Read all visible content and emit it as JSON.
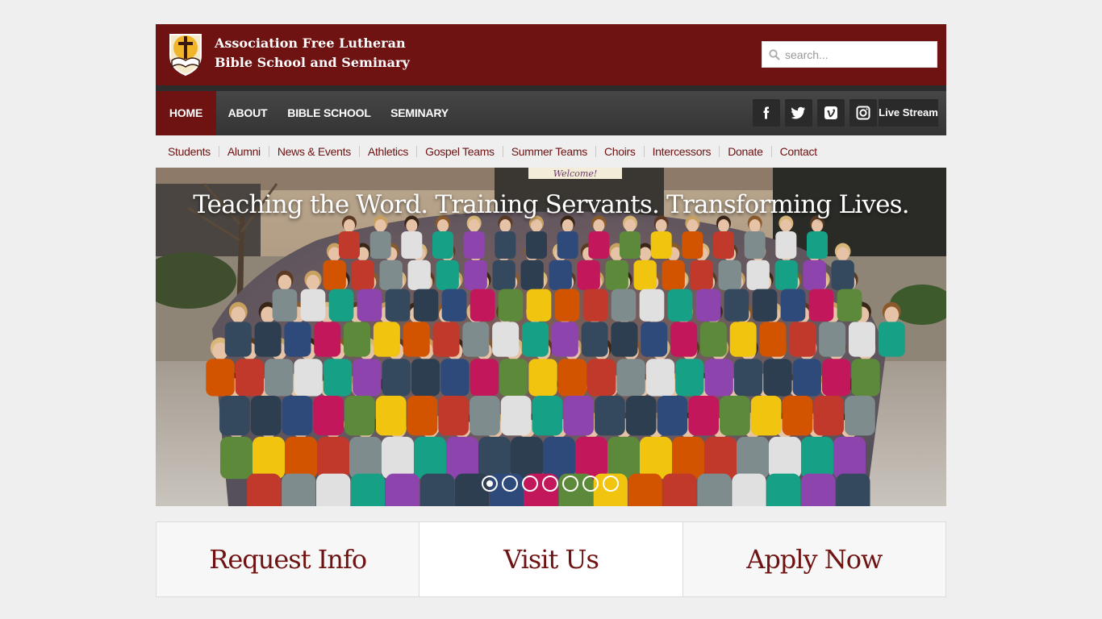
{
  "header": {
    "title_line1": "Association Free Lutheran",
    "title_line2": "Bible School and Seminary",
    "logo_icon": "cross-book-shield-icon",
    "search_placeholder": "search...",
    "brand_color": "#6e1212"
  },
  "nav": {
    "items": [
      "HOME",
      "ABOUT",
      "BIBLE SCHOOL",
      "SEMINARY"
    ],
    "active": "HOME",
    "social": [
      "facebook-icon",
      "twitter-icon",
      "vimeo-icon",
      "instagram-icon"
    ],
    "live_stream": "Live Stream"
  },
  "subnav": {
    "items": [
      "Students",
      "Alumni",
      "News & Events",
      "Athletics",
      "Gospel Teams",
      "Summer Teams",
      "Choirs",
      "Intercessors",
      "Donate",
      "Contact"
    ]
  },
  "hero": {
    "tagline": "Teaching the Word. Training Servants. Transforming Lives.",
    "sign_text": "Welcome!",
    "slides_total": 7,
    "slide_active": 1
  },
  "cta": {
    "request": "Request Info",
    "visit": "Visit Us",
    "apply": "Apply Now"
  }
}
